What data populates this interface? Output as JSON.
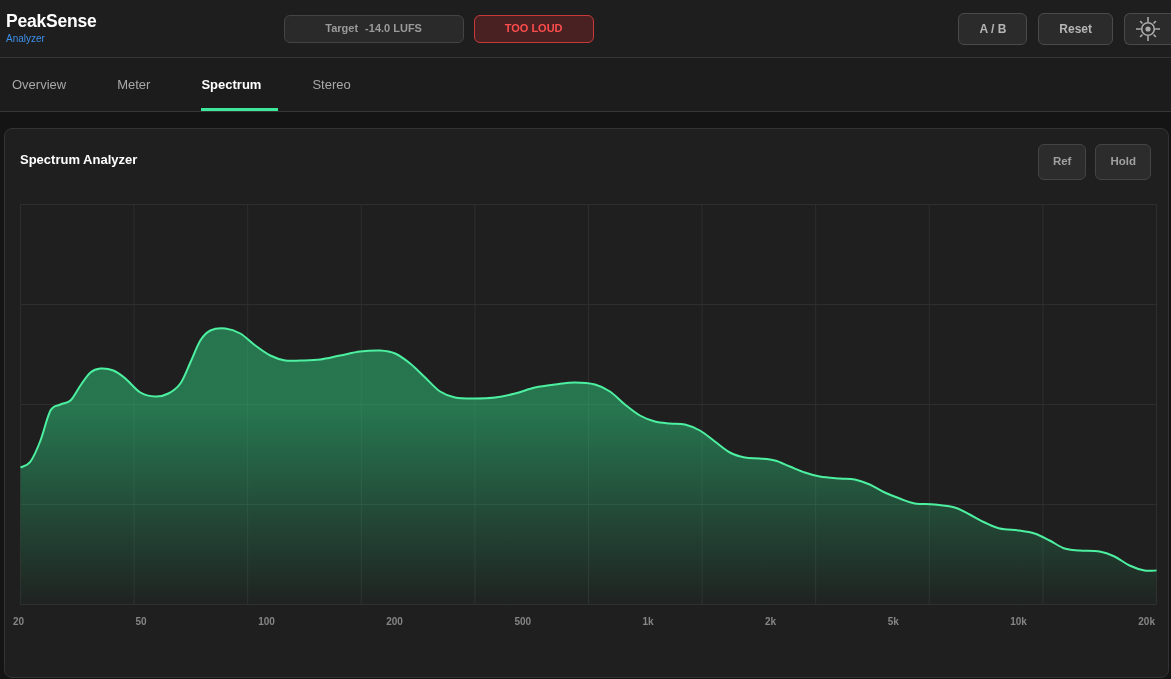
{
  "app": {
    "name": "PeakSense",
    "subtitle": "Analyzer"
  },
  "header": {
    "target": {
      "label": "Target",
      "value": "-14.0 LUFS"
    },
    "status": {
      "text": "TOO LOUD",
      "kind": "alert"
    },
    "buttons": [
      {
        "kind": "text",
        "label": "A / B"
      },
      {
        "kind": "text",
        "label": "Reset"
      },
      {
        "kind": "settings"
      }
    ]
  },
  "tabs": [
    {
      "label": "Overview",
      "selected": false
    },
    {
      "label": "Meter",
      "selected": false
    },
    {
      "label": "Spectrum",
      "selected": true
    },
    {
      "label": "Stereo",
      "selected": false
    }
  ],
  "panel": {
    "title": "Spectrum Analyzer",
    "buttons": [
      "Ref",
      "Hold"
    ],
    "spectrum": {
      "axis_labels": [
        "20",
        "50",
        "100",
        "200",
        "500",
        "1k",
        "2k",
        "5k",
        "10k",
        "20k"
      ]
    }
  }
}
